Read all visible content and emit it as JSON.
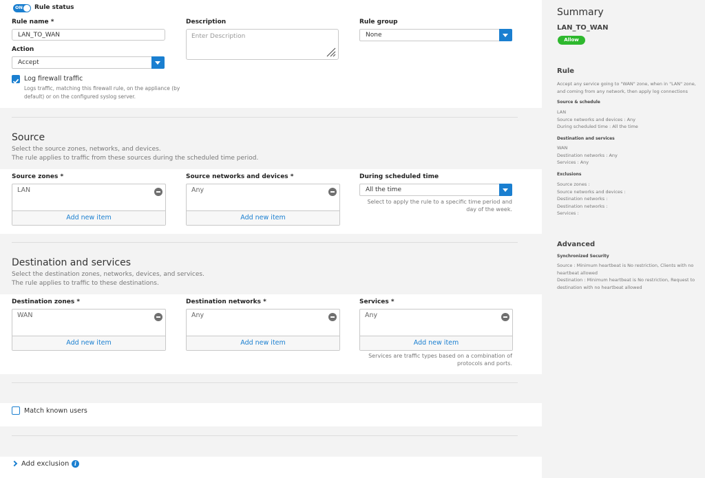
{
  "rule_status": {
    "toggle_label": "ON",
    "label": "Rule status"
  },
  "rule_name": {
    "label": "Rule name *",
    "value": "LAN_TO_WAN"
  },
  "description": {
    "label": "Description",
    "placeholder": "Enter Description"
  },
  "rule_group": {
    "label": "Rule group",
    "value": "None"
  },
  "action": {
    "label": "Action",
    "value": "Accept"
  },
  "log_traffic": {
    "label": "Log firewall traffic",
    "checked": true,
    "help_1": "Logs traffic, matching this firewall rule, on the appliance (by",
    "help_2": "default) or on the configured syslog server."
  },
  "source": {
    "title": "Source",
    "desc_1": "Select the source zones, networks, and devices.",
    "desc_2": "The rule applies to traffic from these sources during the scheduled time period.",
    "zones": {
      "label": "Source zones *",
      "value": "LAN",
      "add": "Add new item"
    },
    "networks": {
      "label": "Source networks and devices *",
      "value": "Any",
      "add": "Add new item"
    },
    "schedule": {
      "label": "During scheduled time",
      "value": "All the time",
      "hint_1": "Select to apply the rule to a specific time period and",
      "hint_2": "day of the week."
    }
  },
  "destination": {
    "title": "Destination and services",
    "desc_1": "Select the destination zones, networks, devices, and services.",
    "desc_2": "The rule applies to traffic to these destinations.",
    "zones": {
      "label": "Destination zones *",
      "value": "WAN",
      "add": "Add new item"
    },
    "networks": {
      "label": "Destination networks *",
      "value": "Any",
      "add": "Add new item"
    },
    "services": {
      "label": "Services *",
      "value": "Any",
      "add": "Add new item",
      "hint_1": "Services are traffic types based on a combination of",
      "hint_2": "protocols and ports."
    }
  },
  "match_users": {
    "label": "Match known users",
    "checked": false
  },
  "add_exclusion": {
    "label": "Add exclusion"
  },
  "summary": {
    "title": "Summary",
    "rule_name": "LAN_TO_WAN",
    "badge": "Allow",
    "rule_heading": "Rule",
    "rule_desc": "Accept any service going to \"WAN\" zone, when in \"LAN\" zone, and coming from any network, then apply log connections",
    "src_heading": "Source & schedule",
    "src_lines": [
      "LAN",
      "Source networks and devices : Any",
      "During scheduled time : All the time"
    ],
    "dst_heading": "Destination and services",
    "dst_lines": [
      "WAN",
      "Destination networks : Any",
      "Services : Any"
    ],
    "excl_heading": "Exclusions",
    "excl_lines": [
      "Source zones :",
      "Source networks and devices :",
      "Destination networks :",
      "Destination networks :",
      "Services :"
    ],
    "advanced_heading": "Advanced",
    "sync_heading": "Synchronized Security",
    "sync_text_1": "Source : Minimum heartbeat is No restriction, Clients with no heartbeat allowed",
    "sync_text_2": "Destination : Minimum heartbeat is No restriction, Request to destination with no heartbeat allowed"
  },
  "colors": {
    "accent": "#1a7fd0",
    "allow": "#2eb82e"
  }
}
